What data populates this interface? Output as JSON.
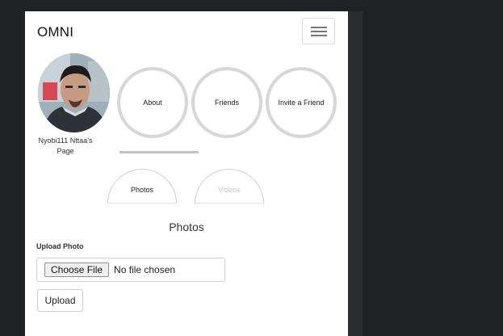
{
  "navbar": {
    "brand": "OMNI",
    "menu_toggle_icon": "hamburger-icon"
  },
  "profile": {
    "owner_name": "Nyobi111 Nttaa's Page",
    "avatar_icon": "profile-photo"
  },
  "circle_nav": [
    {
      "label": "About"
    },
    {
      "label": "Friends"
    },
    {
      "label": "Invite a Friend"
    }
  ],
  "media_tabs": [
    {
      "label": "Photos",
      "active": true
    },
    {
      "label": "Videos",
      "active": false
    }
  ],
  "photos_section": {
    "title": "Photos",
    "upload_label": "Upload Photo",
    "choose_file_label": "Choose File",
    "file_status": "No file chosen",
    "upload_button": "Upload"
  },
  "colors": {
    "page_bg": "#202124",
    "card_bg": "#ffffff",
    "circle_border": "#d7d7d7",
    "inactive_tab_text": "#c6c6c6"
  }
}
